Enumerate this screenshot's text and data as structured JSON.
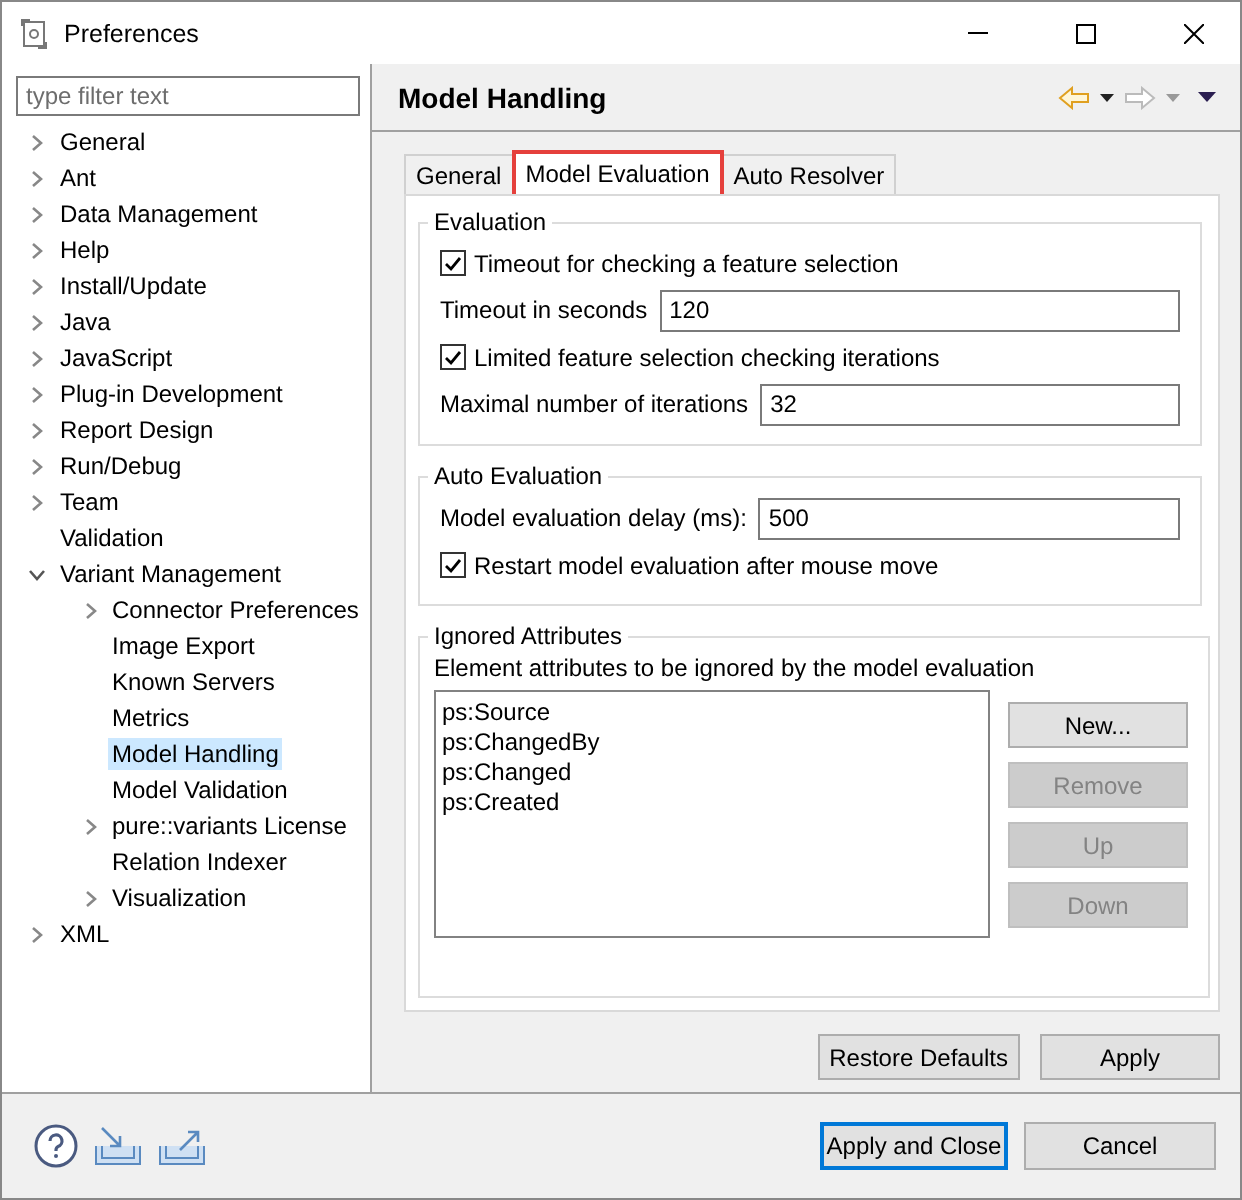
{
  "window": {
    "title": "Preferences"
  },
  "filter": {
    "placeholder": "type filter text"
  },
  "tree": [
    {
      "label": "General",
      "expanded": false,
      "selected": false
    },
    {
      "label": "Ant",
      "expanded": false,
      "selected": false
    },
    {
      "label": "Data Management",
      "expanded": false,
      "selected": false
    },
    {
      "label": "Help",
      "expanded": false,
      "selected": false
    },
    {
      "label": "Install/Update",
      "expanded": false,
      "selected": false
    },
    {
      "label": "Java",
      "expanded": false,
      "selected": false
    },
    {
      "label": "JavaScript",
      "expanded": false,
      "selected": false
    },
    {
      "label": "Plug-in Development",
      "expanded": false,
      "selected": false
    },
    {
      "label": "Report Design",
      "expanded": false,
      "selected": false
    },
    {
      "label": "Run/Debug",
      "expanded": false,
      "selected": false
    },
    {
      "label": "Team",
      "expanded": false,
      "selected": false
    },
    {
      "label": "Validation",
      "selected": false
    },
    {
      "label": "Variant Management",
      "expanded": true,
      "selected": false,
      "children": [
        {
          "label": "Connector Preferences",
          "expanded": false,
          "selected": false
        },
        {
          "label": "Image Export",
          "selected": false
        },
        {
          "label": "Known Servers",
          "selected": false
        },
        {
          "label": "Metrics",
          "selected": false
        },
        {
          "label": "Model Handling",
          "selected": true
        },
        {
          "label": "Model Validation",
          "selected": false
        },
        {
          "label": "pure::variants License",
          "expanded": false,
          "selected": false
        },
        {
          "label": "Relation Indexer",
          "selected": false
        },
        {
          "label": "Visualization",
          "expanded": false,
          "selected": false
        }
      ]
    },
    {
      "label": "XML",
      "expanded": false,
      "selected": false
    }
  ],
  "page": {
    "title": "Model Handling"
  },
  "tabs": [
    {
      "label": "General",
      "selected": false
    },
    {
      "label": "Model Evaluation",
      "selected": true
    },
    {
      "label": "Auto Resolver",
      "selected": false
    }
  ],
  "groups": [
    {
      "title": "Evaluation",
      "rows": [
        {
          "kind": "checkbox",
          "label": "Timeout for checking a feature selection",
          "checked": true
        },
        {
          "kind": "field",
          "label": "Timeout in seconds",
          "value": "120"
        },
        {
          "kind": "checkbox",
          "label": "Limited feature selection checking iterations",
          "checked": true
        },
        {
          "kind": "field",
          "label": "Maximal number of iterations",
          "value": "32"
        }
      ]
    },
    {
      "title": "Auto Evaluation",
      "rows": [
        {
          "kind": "field",
          "label": "Model evaluation delay (ms):",
          "value": "500"
        },
        {
          "kind": "checkbox",
          "label": "Restart model evaluation after mouse move",
          "checked": true
        }
      ]
    }
  ],
  "ignored": {
    "title": "Ignored Attributes",
    "description": "Element attributes to be ignored by the model evaluation",
    "items": [
      "ps:Source",
      "ps:ChangedBy",
      "ps:Changed",
      "ps:Created"
    ],
    "buttons": [
      {
        "label": "New...",
        "disabled": false
      },
      {
        "label": "Remove",
        "disabled": true
      },
      {
        "label": "Up",
        "disabled": true
      },
      {
        "label": "Down",
        "disabled": true
      }
    ]
  },
  "page_buttons": [
    {
      "label": "Restore Defaults"
    },
    {
      "label": "Apply"
    }
  ],
  "dialog_buttons": [
    {
      "label": "Apply and Close",
      "default": true
    },
    {
      "label": "Cancel",
      "default": false
    }
  ]
}
